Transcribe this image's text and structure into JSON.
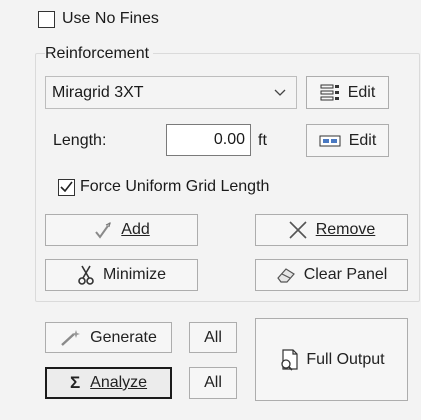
{
  "use_no_fines": {
    "label": "Use No Fines",
    "checked": false
  },
  "reinforcement": {
    "group_label": "Reinforcement",
    "selected_material": "Miragrid 3XT",
    "material_edit_label": "Edit",
    "length_label": "Length:",
    "length_value": "0.00",
    "length_unit": "ft",
    "length_edit_label": "Edit",
    "force_uniform": {
      "label": "Force Uniform Grid Length",
      "checked": true
    },
    "add_label": "Add",
    "remove_label": "Remove",
    "minimize_label": "Minimize",
    "clear_panel_label": "Clear Panel"
  },
  "actions": {
    "generate_label": "Generate",
    "generate_all_label": "All",
    "analyze_label": "Analyze",
    "analyze_symbol": "Σ",
    "analyze_all_label": "All",
    "full_output_label": "Full Output"
  },
  "icons": {
    "add": "pencil-check-icon",
    "remove": "x-icon",
    "minimize": "scissors-icon",
    "clear_panel": "eraser-icon",
    "generate": "wand-icon",
    "full_output": "document-icon",
    "material_edit": "list-grid-icon",
    "length_edit": "ruler-icon",
    "dropdown": "chevron-down-icon"
  }
}
